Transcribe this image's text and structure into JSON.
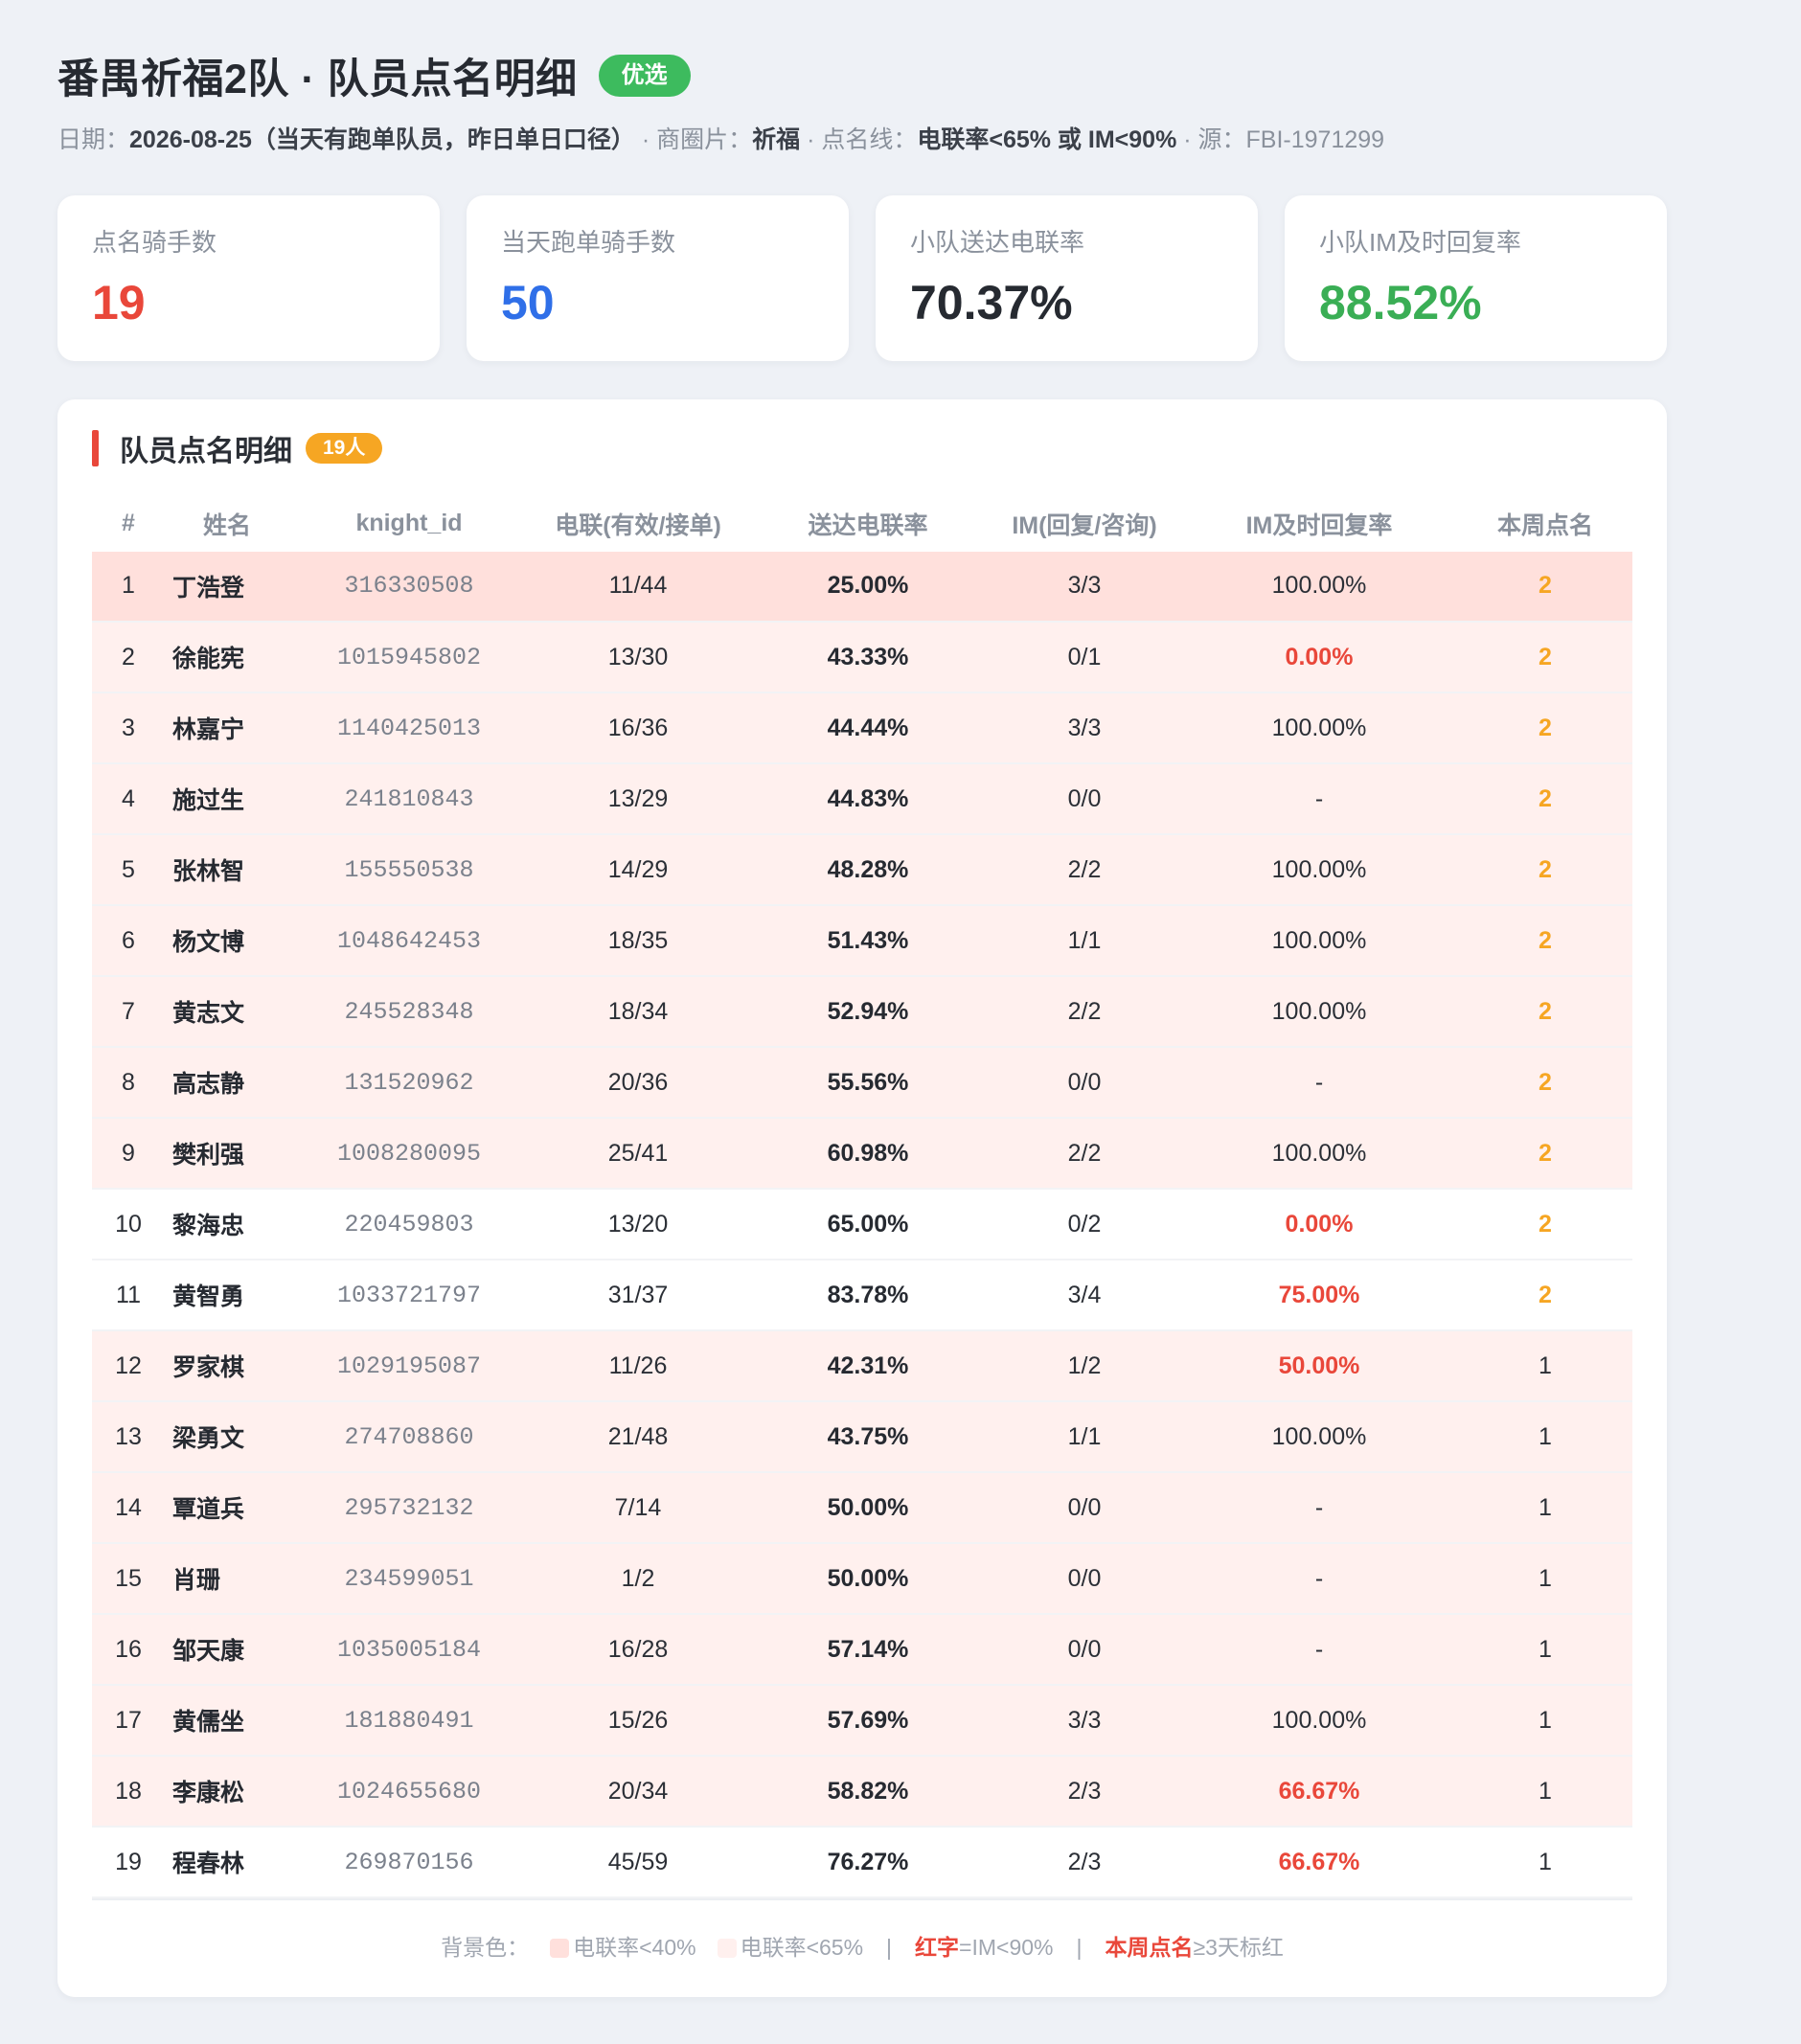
{
  "header": {
    "title": "番禺祈福2队 · 队员点名明细",
    "badge": "优选",
    "date_label": "日期：",
    "date_value": "2026-08-25（当天有跑单队员，昨日单日口径）",
    "area_label": " · 商圈片：",
    "area_value": "祈福",
    "line_label": " · 点名线：",
    "line_value": "电联率<65% 或 IM<90%",
    "source_label": " · 源：FBI-1971299"
  },
  "cards": [
    {
      "label": "点名骑手数",
      "value": "19",
      "color": "#e9473a"
    },
    {
      "label": "当天跑单骑手数",
      "value": "50",
      "color": "#2f6fe8"
    },
    {
      "label": "小队送达电联率",
      "value": "70.37%",
      "color": "#262a31"
    },
    {
      "label": "小队IM及时回复率",
      "value": "88.52%",
      "color": "#3aae55"
    }
  ],
  "panel": {
    "title": "队员点名明细",
    "count_badge": "19人"
  },
  "columns": [
    "#",
    "姓名",
    "knight_id",
    "电联(有效/接单)",
    "送达电联率",
    "IM(回复/咨询)",
    "IM及时回复率",
    "本周点名"
  ],
  "rows": [
    {
      "no": "1",
      "name": "丁浩登",
      "id": "316330508",
      "call": "11/44",
      "rate": "25.00%",
      "im": "3/3",
      "im_rate": "100.00%",
      "im_red": false,
      "week": "2",
      "week_hl": true,
      "level": 1
    },
    {
      "no": "2",
      "name": "徐能宪",
      "id": "1015945802",
      "call": "13/30",
      "rate": "43.33%",
      "im": "0/1",
      "im_rate": "0.00%",
      "im_red": true,
      "week": "2",
      "week_hl": true,
      "level": 2
    },
    {
      "no": "3",
      "name": "林嘉宁",
      "id": "1140425013",
      "call": "16/36",
      "rate": "44.44%",
      "im": "3/3",
      "im_rate": "100.00%",
      "im_red": false,
      "week": "2",
      "week_hl": true,
      "level": 2
    },
    {
      "no": "4",
      "name": "施过生",
      "id": "241810843",
      "call": "13/29",
      "rate": "44.83%",
      "im": "0/0",
      "im_rate": "-",
      "im_red": false,
      "week": "2",
      "week_hl": true,
      "level": 2
    },
    {
      "no": "5",
      "name": "张林智",
      "id": "155550538",
      "call": "14/29",
      "rate": "48.28%",
      "im": "2/2",
      "im_rate": "100.00%",
      "im_red": false,
      "week": "2",
      "week_hl": true,
      "level": 2
    },
    {
      "no": "6",
      "name": "杨文博",
      "id": "1048642453",
      "call": "18/35",
      "rate": "51.43%",
      "im": "1/1",
      "im_rate": "100.00%",
      "im_red": false,
      "week": "2",
      "week_hl": true,
      "level": 2
    },
    {
      "no": "7",
      "name": "黄志文",
      "id": "245528348",
      "call": "18/34",
      "rate": "52.94%",
      "im": "2/2",
      "im_rate": "100.00%",
      "im_red": false,
      "week": "2",
      "week_hl": true,
      "level": 2
    },
    {
      "no": "8",
      "name": "高志静",
      "id": "131520962",
      "call": "20/36",
      "rate": "55.56%",
      "im": "0/0",
      "im_rate": "-",
      "im_red": false,
      "week": "2",
      "week_hl": true,
      "level": 2
    },
    {
      "no": "9",
      "name": "樊利强",
      "id": "1008280095",
      "call": "25/41",
      "rate": "60.98%",
      "im": "2/2",
      "im_rate": "100.00%",
      "im_red": false,
      "week": "2",
      "week_hl": true,
      "level": 2
    },
    {
      "no": "10",
      "name": "黎海忠",
      "id": "220459803",
      "call": "13/20",
      "rate": "65.00%",
      "im": "0/2",
      "im_rate": "0.00%",
      "im_red": true,
      "week": "2",
      "week_hl": true,
      "level": 0
    },
    {
      "no": "11",
      "name": "黄智勇",
      "id": "1033721797",
      "call": "31/37",
      "rate": "83.78%",
      "im": "3/4",
      "im_rate": "75.00%",
      "im_red": true,
      "week": "2",
      "week_hl": true,
      "level": 0
    },
    {
      "no": "12",
      "name": "罗家棋",
      "id": "1029195087",
      "call": "11/26",
      "rate": "42.31%",
      "im": "1/2",
      "im_rate": "50.00%",
      "im_red": true,
      "week": "1",
      "week_hl": false,
      "level": 2
    },
    {
      "no": "13",
      "name": "梁勇文",
      "id": "274708860",
      "call": "21/48",
      "rate": "43.75%",
      "im": "1/1",
      "im_rate": "100.00%",
      "im_red": false,
      "week": "1",
      "week_hl": false,
      "level": 2
    },
    {
      "no": "14",
      "name": "覃道兵",
      "id": "295732132",
      "call": "7/14",
      "rate": "50.00%",
      "im": "0/0",
      "im_rate": "-",
      "im_red": false,
      "week": "1",
      "week_hl": false,
      "level": 2
    },
    {
      "no": "15",
      "name": "肖珊",
      "id": "234599051",
      "call": "1/2",
      "rate": "50.00%",
      "im": "0/0",
      "im_rate": "-",
      "im_red": false,
      "week": "1",
      "week_hl": false,
      "level": 2
    },
    {
      "no": "16",
      "name": "邹天康",
      "id": "1035005184",
      "call": "16/28",
      "rate": "57.14%",
      "im": "0/0",
      "im_rate": "-",
      "im_red": false,
      "week": "1",
      "week_hl": false,
      "level": 2
    },
    {
      "no": "17",
      "name": "黄儒坐",
      "id": "181880491",
      "call": "15/26",
      "rate": "57.69%",
      "im": "3/3",
      "im_rate": "100.00%",
      "im_red": false,
      "week": "1",
      "week_hl": false,
      "level": 2
    },
    {
      "no": "18",
      "name": "李康松",
      "id": "1024655680",
      "call": "20/34",
      "rate": "58.82%",
      "im": "2/3",
      "im_rate": "66.67%",
      "im_red": true,
      "week": "1",
      "week_hl": false,
      "level": 2
    },
    {
      "no": "19",
      "name": "程春林",
      "id": "269870156",
      "call": "45/59",
      "rate": "76.27%",
      "im": "2/3",
      "im_rate": "66.67%",
      "im_red": true,
      "week": "1",
      "week_hl": false,
      "level": 0
    }
  ],
  "legend": {
    "prefix": "背景色：",
    "swatch1_color": "#ffe0dc",
    "swatch1_text": "电联率<40%",
    "swatch2_color": "#fff0ee",
    "swatch2_text": "电联率<65%",
    "sep": "|",
    "red_word": "红字",
    "red_rest": "=IM<90%",
    "week_word": "本周点名",
    "week_rest": "≥3天标红"
  }
}
